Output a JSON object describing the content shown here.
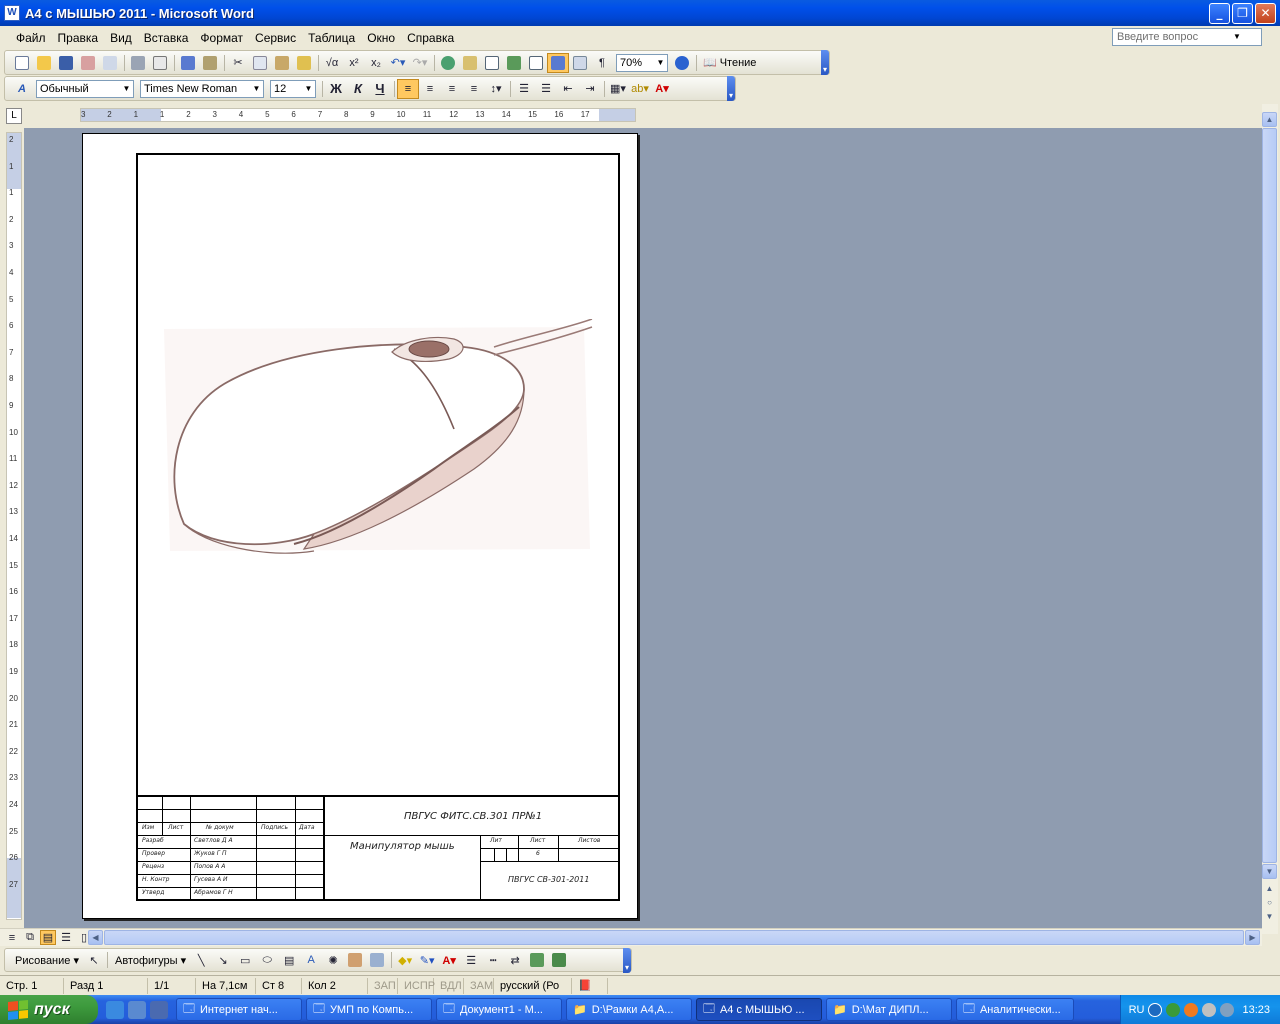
{
  "window": {
    "title": "А4 с МЫШЬЮ 2011 - Microsoft Word",
    "app_icon": "W"
  },
  "menu": [
    "Файл",
    "Правка",
    "Вид",
    "Вставка",
    "Формат",
    "Сервис",
    "Таблица",
    "Окно",
    "Справка"
  ],
  "help_box": {
    "placeholder": "Введите вопрос"
  },
  "standard_toolbar": {
    "zoom": "70%",
    "reading_label": "Чтение"
  },
  "formatting_toolbar": {
    "style": "Обычный",
    "font": "Times New Roman",
    "size": "12",
    "bold": "Ж",
    "italic": "К",
    "underline": "Ч"
  },
  "hruler": {
    "labels": [
      "3",
      "2",
      "1",
      "1",
      "2",
      "3",
      "4",
      "5",
      "6",
      "7",
      "8",
      "9",
      "10",
      "11",
      "12",
      "13",
      "14",
      "15",
      "16",
      "17"
    ]
  },
  "vruler": {
    "labels": [
      "2",
      "1",
      "1",
      "2",
      "3",
      "4",
      "5",
      "6",
      "7",
      "8",
      "9",
      "10",
      "11",
      "12",
      "13",
      "14",
      "15",
      "16",
      "17",
      "18",
      "19",
      "20",
      "21",
      "22",
      "23",
      "24",
      "25",
      "26",
      "27"
    ]
  },
  "stamp": {
    "designation": "ПВГУС ФИТС.СВ.301 ПР№1",
    "name": "Манипулятор мышь",
    "org": "ПВГУС СВ-301-2011",
    "head_izm": "Изм",
    "head_list": "Лист",
    "head_doc": "№ докум",
    "head_sign": "Подпись",
    "head_date": "Дата",
    "lit": "Лит",
    "list": "Лист",
    "listov": "Листов",
    "list_num": "6",
    "roles": [
      "Разраб",
      "Провер",
      "Реценз",
      "Н. Контр",
      "Утверд"
    ],
    "names": [
      "Светлов Д А",
      "Жуков Г П",
      "Попов А А",
      "Гусева А И",
      "Абрамов Г Н"
    ]
  },
  "drawing_toolbar": {
    "draw": "Рисование",
    "autoshapes": "Автофигуры"
  },
  "status": {
    "page": "Стр. 1",
    "section": "Разд 1",
    "pages": "1/1",
    "at": "На 7,1см",
    "line": "Ст 8",
    "col": "Кол 2",
    "rec": "ЗАП",
    "trk": "ИСПР",
    "ext": "ВДЛ",
    "ovr": "ЗАМ",
    "lang": "русский (Ро"
  },
  "taskbar": {
    "start": "пуск",
    "tasks": [
      "Интернет нач...",
      "УМП по Компь...",
      "Документ1 - М...",
      "D:\\Рамки А4,А...",
      "А4 с МЫШЬЮ ...",
      "D:\\Мат ДИПЛ...",
      "Аналитически..."
    ],
    "lang": "RU",
    "clock": "13:23"
  }
}
